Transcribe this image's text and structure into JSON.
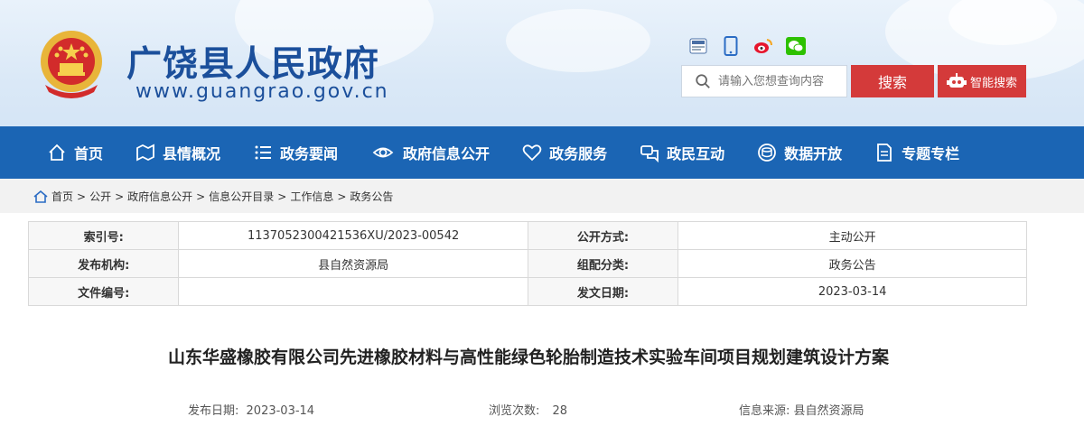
{
  "site": {
    "title": "广饶县人民政府",
    "url": "www.guangrao.gov.cn"
  },
  "header": {
    "search_placeholder": "请输入您想查询内容",
    "search_label": "搜索",
    "smart_search_label": "智能搜索",
    "quick_icons": [
      "accessibility-icon",
      "mobile-icon",
      "weibo-icon",
      "wechat-icon"
    ]
  },
  "nav": {
    "items": [
      {
        "label": "首页",
        "icon": "home-icon"
      },
      {
        "label": "县情概况",
        "icon": "map-icon"
      },
      {
        "label": "政务要闻",
        "icon": "list-icon"
      },
      {
        "label": "政府信息公开",
        "icon": "eye-icon"
      },
      {
        "label": "政务服务",
        "icon": "heart-icon"
      },
      {
        "label": "政民互动",
        "icon": "chat-icon"
      },
      {
        "label": "数据开放",
        "icon": "database-icon"
      },
      {
        "label": "专题专栏",
        "icon": "document-icon"
      }
    ]
  },
  "breadcrumb": {
    "items": [
      "首页",
      "公开",
      "政府信息公开",
      "信息公开目录",
      "工作信息",
      "政务公告"
    ]
  },
  "info": {
    "rows": [
      {
        "label1": "索引号:",
        "value1": "1137052300421536XU/2023-00542",
        "label2": "公开方式:",
        "value2": "主动公开"
      },
      {
        "label1": "发布机构:",
        "value1": "县自然资源局",
        "label2": "组配分类:",
        "value2": "政务公告"
      },
      {
        "label1": "文件编号:",
        "value1": "",
        "label2": "发文日期:",
        "value2": "2023-03-14"
      }
    ]
  },
  "article": {
    "title": "山东华盛橡胶有限公司先进橡胶材料与高性能绿色轮胎制造技术实验车间项目规划建筑设计方案",
    "publish_date_label": "发布日期:",
    "publish_date": "2023-03-14",
    "views_label": "浏览次数:",
    "views": "28",
    "source_label": "信息来源:",
    "source": "县自然资源局"
  },
  "colors": {
    "brand_blue": "#1b65b4",
    "title_blue": "#1b4f9b",
    "search_red": "#d43a3a"
  }
}
